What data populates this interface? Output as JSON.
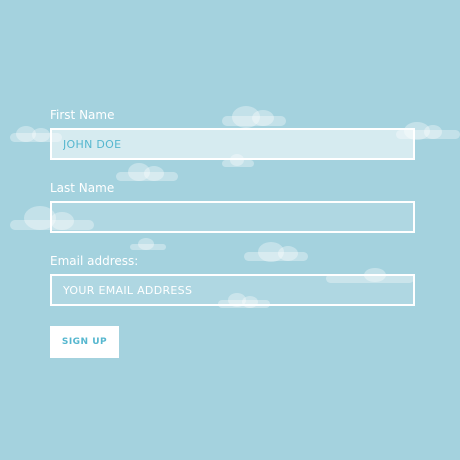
{
  "form": {
    "first_name": {
      "label": "First Name",
      "value": "JOHN DOE",
      "placeholder": ""
    },
    "last_name": {
      "label": "Last Name",
      "value": "",
      "placeholder": ""
    },
    "email": {
      "label": "Email address:",
      "value": "",
      "placeholder": "YOUR EMAIL ADDRESS"
    },
    "submit_label": "SIGN UP"
  },
  "colors": {
    "background": "#a4d2de",
    "accent": "#56b7cf",
    "field_border": "#ffffff"
  }
}
